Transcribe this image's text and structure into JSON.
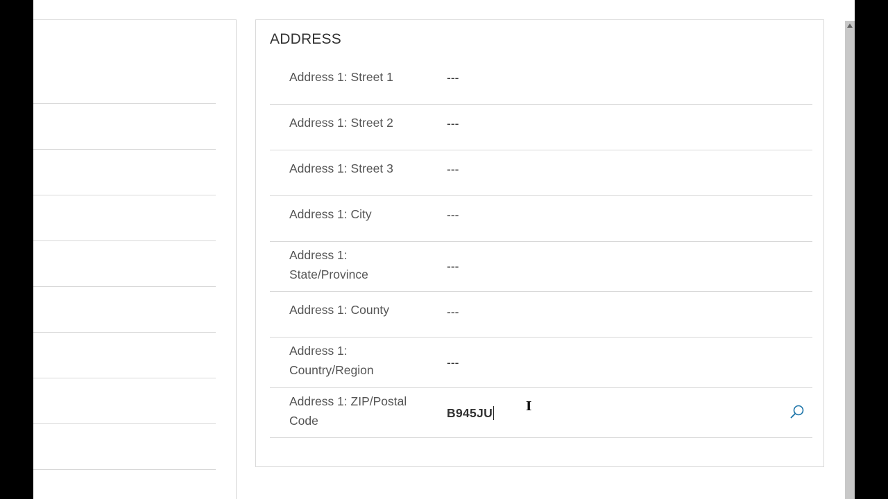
{
  "address": {
    "title": "ADDRESS",
    "fields": [
      {
        "label": "Address 1: Street 1",
        "value": "---"
      },
      {
        "label": "Address 1: Street 2",
        "value": "---"
      },
      {
        "label": "Address 1: Street 3",
        "value": "---"
      },
      {
        "label": "Address 1: City",
        "value": "---"
      },
      {
        "label": "Address 1: State/Province",
        "value": "---"
      },
      {
        "label": "Address 1: County",
        "value": "---"
      },
      {
        "label": "Address 1: Country/Region",
        "value": "---"
      },
      {
        "label": "Address 1: ZIP/Postal Code",
        "value": "B945JU"
      }
    ]
  },
  "icons": {
    "lookup": "search-icon",
    "cursor": "text-cursor-icon",
    "scroll_up": "chevron-up-icon"
  },
  "colors": {
    "accent": "#1a73a8",
    "divider": "#d8d8d8",
    "label": "#555555",
    "background": "#ffffff",
    "scrollbar": "#c8c8c8"
  }
}
